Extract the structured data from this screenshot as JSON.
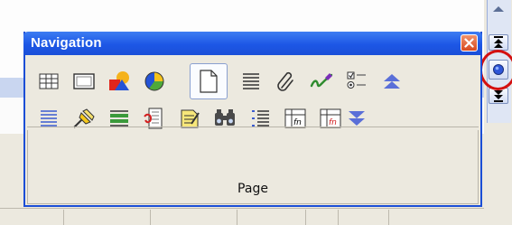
{
  "window": {
    "title": "Navigation",
    "footer_label": "Page"
  },
  "toolbar_row1": [
    {
      "name": "table-icon"
    },
    {
      "name": "frame-icon"
    },
    {
      "name": "graphics-icon"
    },
    {
      "name": "ole-object-icon"
    },
    {
      "name": "page-icon",
      "active": true
    },
    {
      "name": "heading-icon"
    },
    {
      "name": "reflist-paperclip-icon"
    },
    {
      "name": "note-check-icon"
    },
    {
      "name": "control-icon"
    },
    {
      "name": "previous-object-icon"
    }
  ],
  "toolbar_row2": [
    {
      "name": "section-icon"
    },
    {
      "name": "bookmark-icon"
    },
    {
      "name": "selection-icon"
    },
    {
      "name": "index-entry-icon"
    },
    {
      "name": "comment-icon"
    },
    {
      "name": "drawing-object-icon"
    },
    {
      "name": "field-icon"
    },
    {
      "name": "table-formula-icon"
    },
    {
      "name": "wrong-table-formula-icon"
    },
    {
      "name": "next-object-icon"
    }
  ],
  "scrollbar": {
    "buttons": [
      "scroll-up-icon",
      "previous-page-icon",
      "browse-object-icon",
      "next-page-icon"
    ]
  }
}
